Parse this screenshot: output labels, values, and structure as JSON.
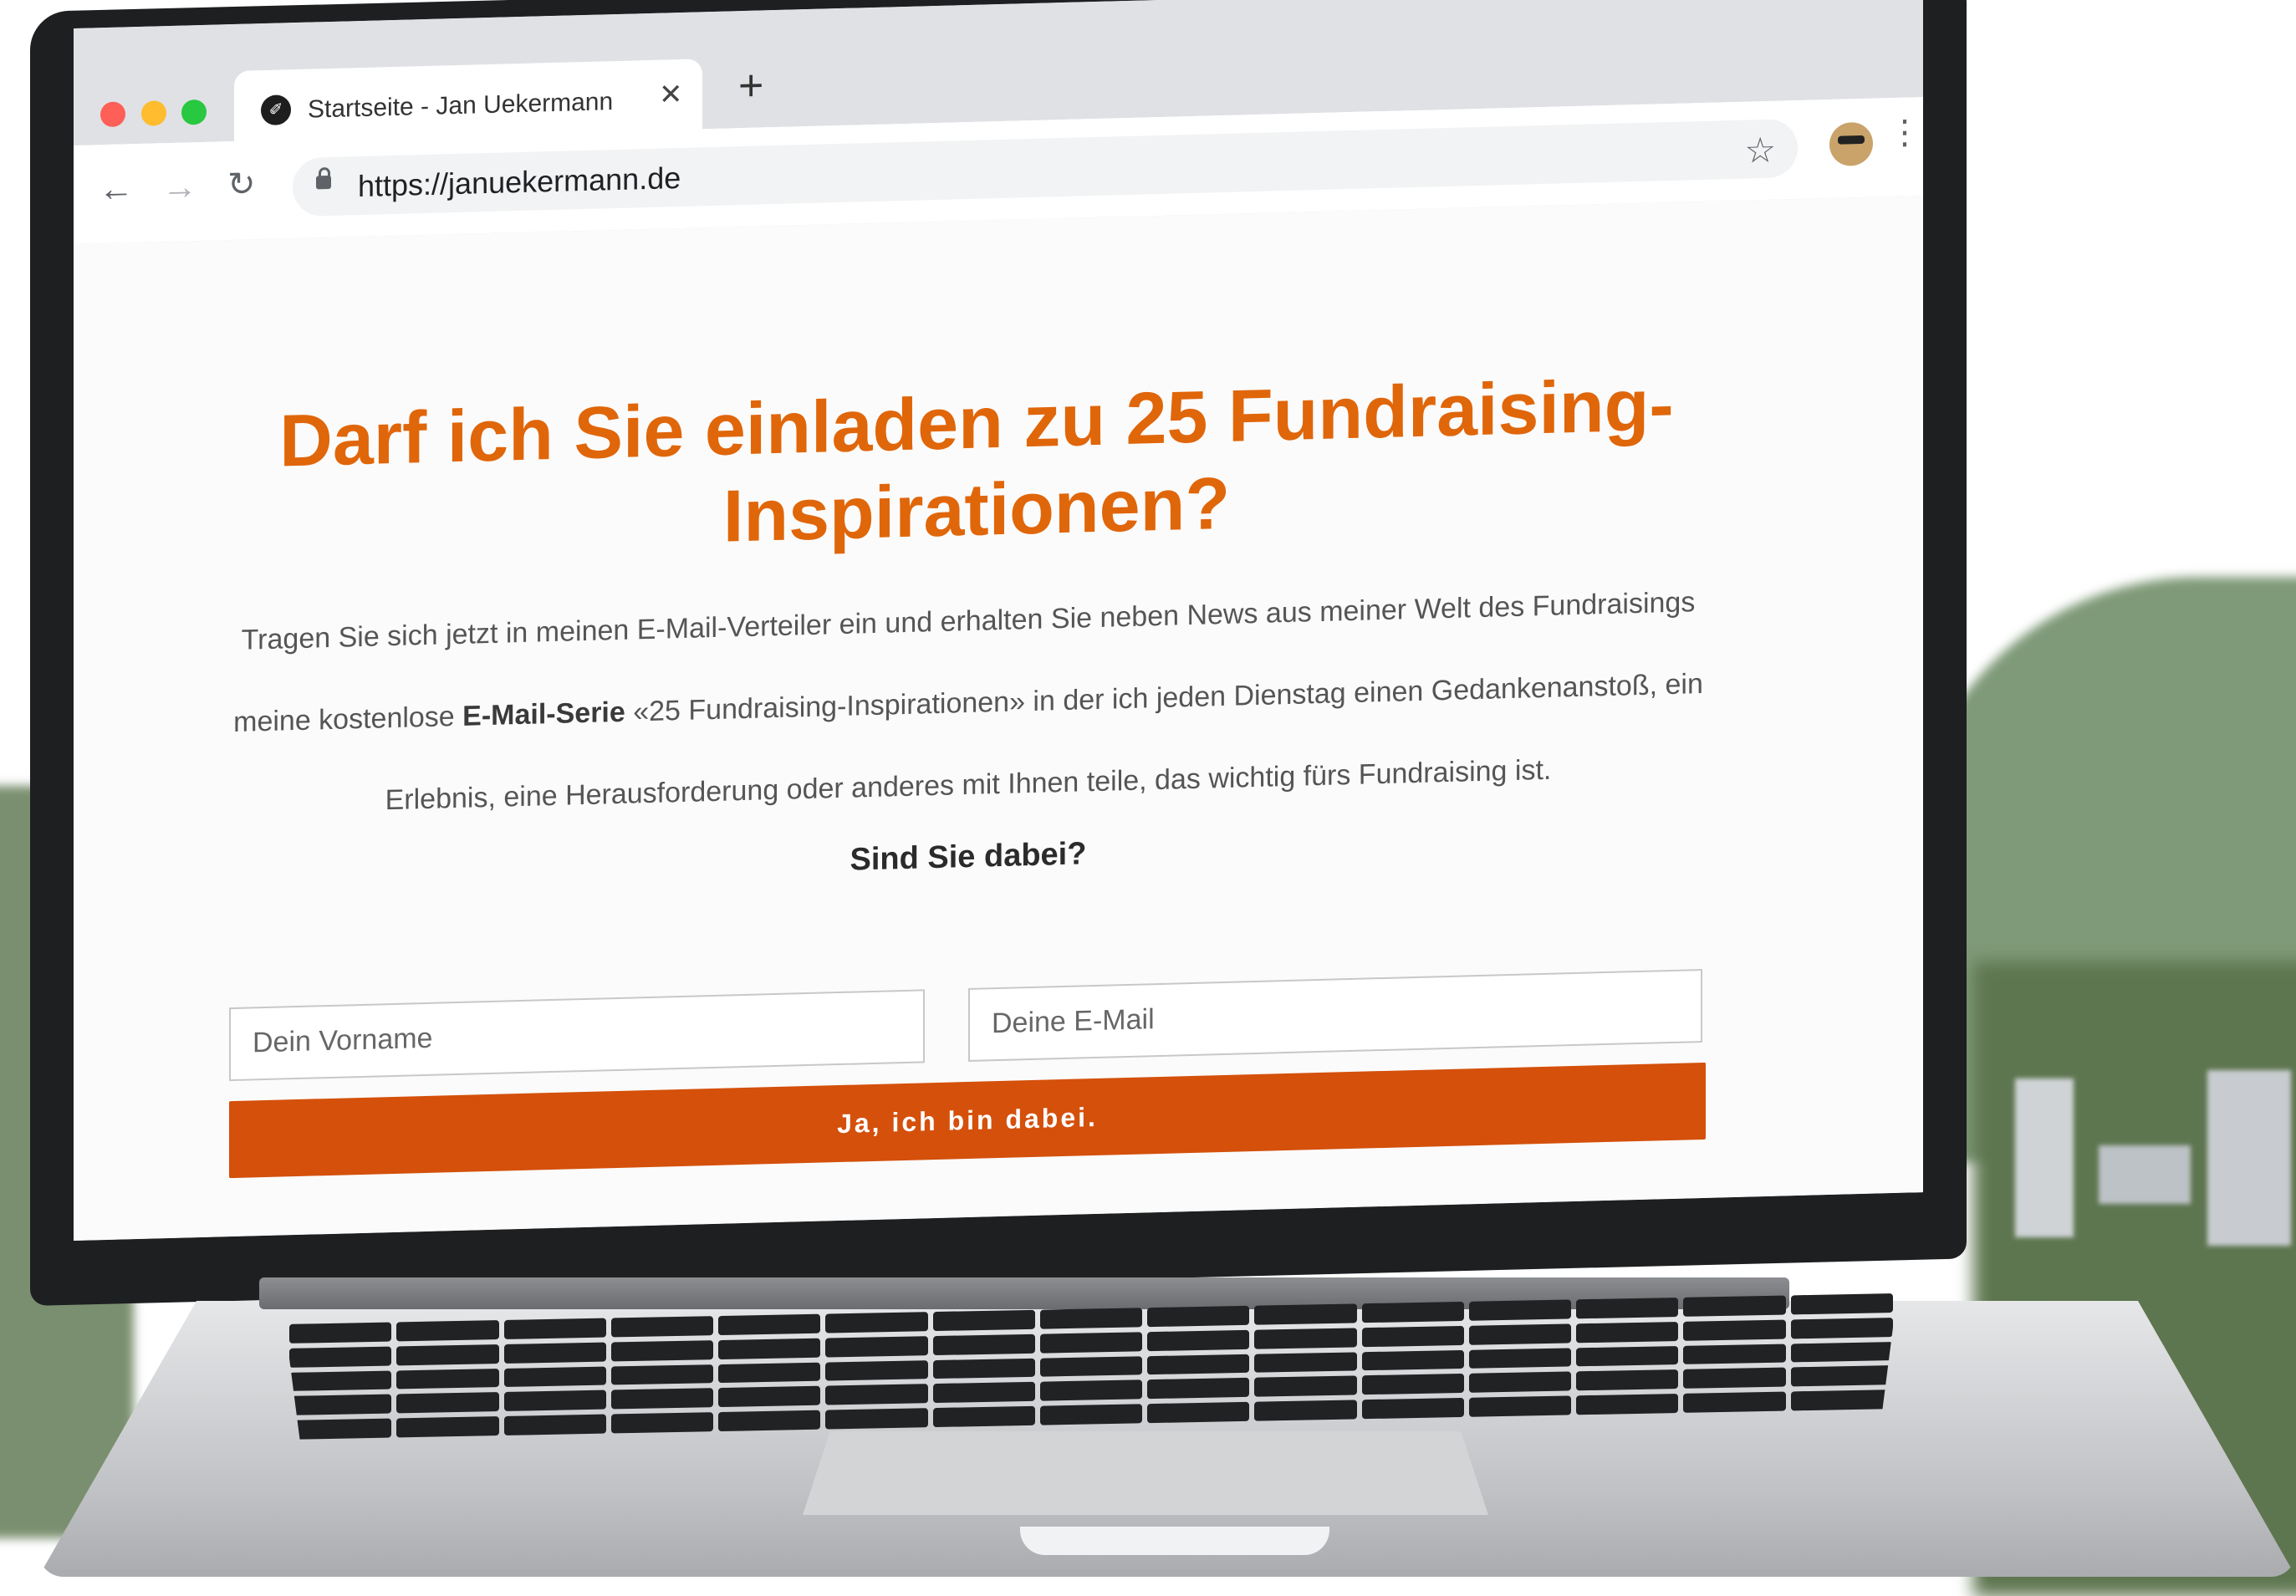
{
  "browser": {
    "tab_title": "Startseite - Jan Uekermann",
    "tab_close": "✕",
    "new_tab": "+",
    "url": "https://januekermann.de",
    "back_icon": "←",
    "forward_icon": "→",
    "reload_icon": "↻",
    "star_icon": "☆",
    "menu_icon": "⋮",
    "favicon": "✐"
  },
  "page": {
    "headline": "Darf ich Sie einladen zu 25 Fundraising-Inspirationen?",
    "lead_part1": "Tragen Sie sich jetzt in meinen E-Mail-Verteiler ein und erhalten Sie neben News aus meiner Welt des Fundraisings meine kostenlose ",
    "lead_bold": "E-Mail-Serie",
    "lead_part2": " «25 Fundraising-Inspirationen» in der ich jeden Dienstag einen Gedankenanstoß, ein Erlebnis, eine Herausforderung oder anderes mit Ihnen teile, das wichtig fürs Fundraising ist.",
    "question": "Sind Sie dabei?",
    "firstname_placeholder": "Dein Vorname",
    "email_placeholder": "Deine E-Mail",
    "submit_label": "Ja, ich bin dabei."
  },
  "colors": {
    "accent_headline": "#e0660a",
    "button": "#d4500b"
  }
}
